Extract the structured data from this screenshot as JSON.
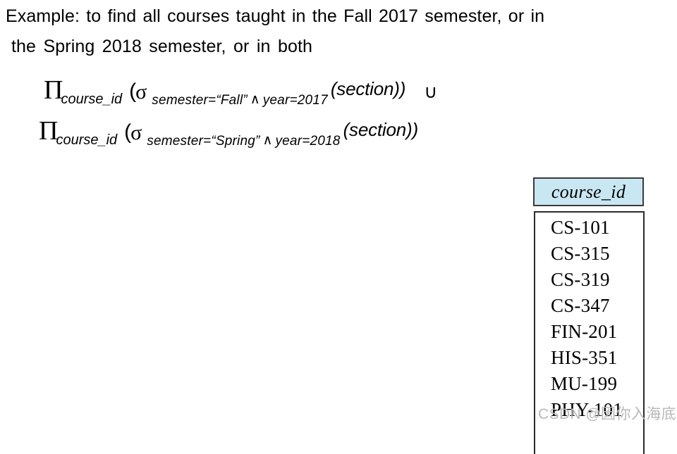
{
  "prompt": {
    "line1": "Example: to find all courses taught in the Fall 2017 semester, or in",
    "line2": "the Spring 2018 semester, or in both"
  },
  "expressions": [
    {
      "projection_symbol": "Π",
      "projection_attribute": "course_id",
      "open_paren": "(",
      "selection_symbol": "σ",
      "condition_1": "semester=“Fall”",
      "conjunction": "∧",
      "condition_2": "year=2017",
      "relation": "(section))",
      "operator": "∪"
    },
    {
      "projection_symbol": "Π",
      "projection_attribute": "course_id",
      "open_paren": "(",
      "selection_symbol": "σ",
      "condition_1": "semester=“Spring”",
      "conjunction": "∧",
      "condition_2": "year=2018",
      "relation": "(section))",
      "operator": ""
    }
  ],
  "result_table": {
    "header": "course_id",
    "rows": [
      "CS-101",
      "CS-315",
      "CS-319",
      "CS-347",
      "FIN-201",
      "HIS-351",
      "MU-199",
      "PHY-101"
    ],
    "header_background": "#c9e7f2",
    "border_color": "#2b2b2b"
  },
  "watermark": {
    "text": "CSDN @因你入海底",
    "color": "#b9b9b9"
  }
}
